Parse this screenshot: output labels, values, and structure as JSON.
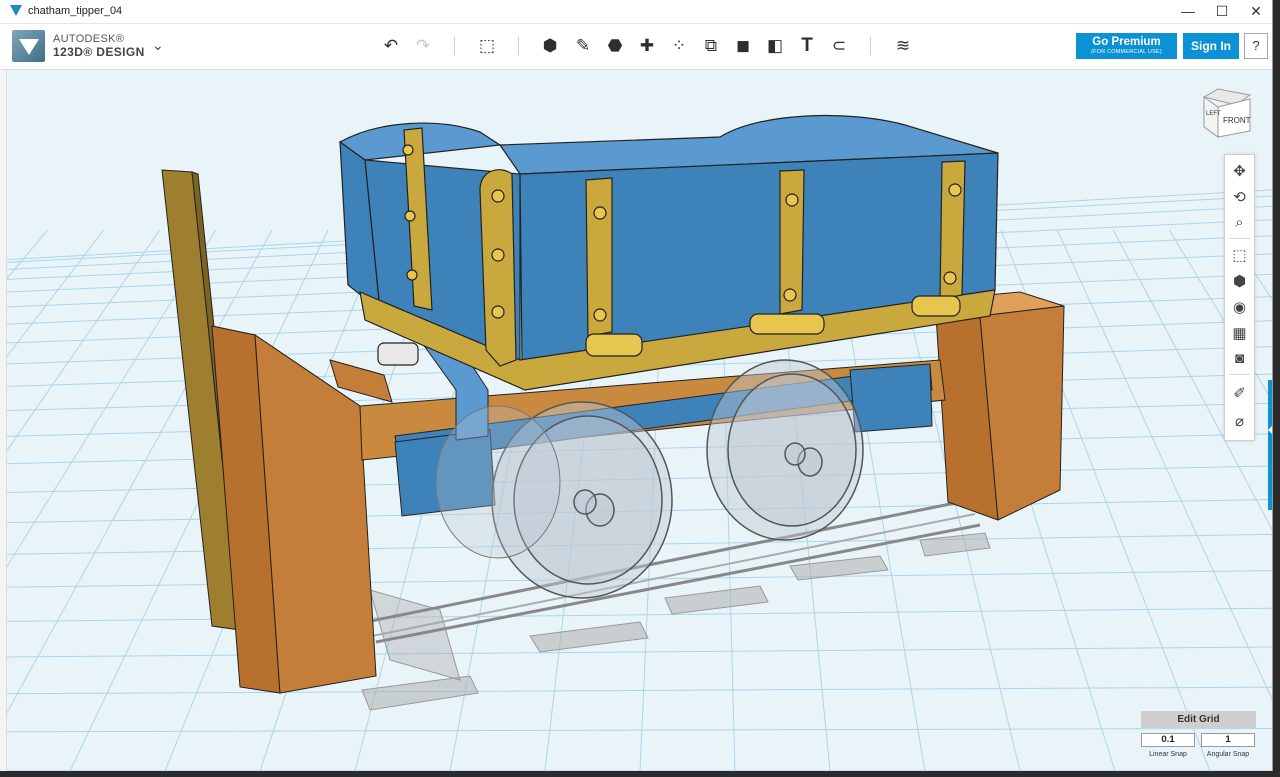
{
  "window": {
    "title": "chatham_tipper_04",
    "controls": {
      "minimize": "—",
      "maximize": "☐",
      "close": "✕"
    }
  },
  "app": {
    "brand_line1": "AUTODESK®",
    "brand_line2": "123D® DESIGN",
    "menu_icon": "chevron-down-icon"
  },
  "toolbar": {
    "undo_icon": "↶",
    "redo_icon": "↷",
    "tools": [
      {
        "name": "transform-icon",
        "glyph": "⬚"
      },
      {
        "name": "primitives-icon",
        "glyph": "⬢"
      },
      {
        "name": "sketch-icon",
        "glyph": "✎"
      },
      {
        "name": "construct-icon",
        "glyph": "⬣"
      },
      {
        "name": "modify-icon",
        "glyph": "✚"
      },
      {
        "name": "pattern-icon",
        "glyph": "⁘"
      },
      {
        "name": "grouping-icon",
        "glyph": "⧉"
      },
      {
        "name": "combine-icon",
        "glyph": "◼"
      },
      {
        "name": "measure-icon",
        "glyph": "◧"
      },
      {
        "name": "text-icon",
        "glyph": "T"
      },
      {
        "name": "snap-icon",
        "glyph": "⊂"
      },
      {
        "name": "material-icon",
        "glyph": "≋"
      }
    ],
    "go_premium_label": "Go Premium",
    "go_premium_sub": "(FOR COMMERCIAL USE)",
    "sign_in_label": "Sign In",
    "help_label": "?"
  },
  "viewcube": {
    "left_label": "LEFT",
    "front_label": "FRONT"
  },
  "navbar": [
    {
      "name": "pan-icon",
      "glyph": "✥"
    },
    {
      "name": "orbit-icon",
      "glyph": "⟲"
    },
    {
      "name": "zoom-icon",
      "glyph": "⌕"
    },
    {
      "name": "fit-icon",
      "glyph": "⬚"
    },
    {
      "name": "view-icon",
      "glyph": "⬢"
    },
    {
      "name": "visibility-icon",
      "glyph": "◉"
    },
    {
      "name": "materials-outline-icon",
      "glyph": "▦"
    },
    {
      "name": "camera-icon",
      "glyph": "◙"
    },
    {
      "name": "hide-sketch-icon",
      "glyph": "✐"
    },
    {
      "name": "hide-mesh-icon",
      "glyph": "⌀"
    }
  ],
  "edit_grid": {
    "title": "Edit Grid",
    "linear_snap_value": "0.1",
    "angular_snap_value": "1",
    "linear_snap_label": "Linear Snap",
    "angular_snap_label": "Angular Snap"
  },
  "colors": {
    "accent": "#0b92d6",
    "grid_line": "#a9d6ea",
    "viewport_bg": "#e9f4f8",
    "body_blue": "#3d82b8",
    "brass": "#c9a93d",
    "wood": "#c47e3a"
  }
}
